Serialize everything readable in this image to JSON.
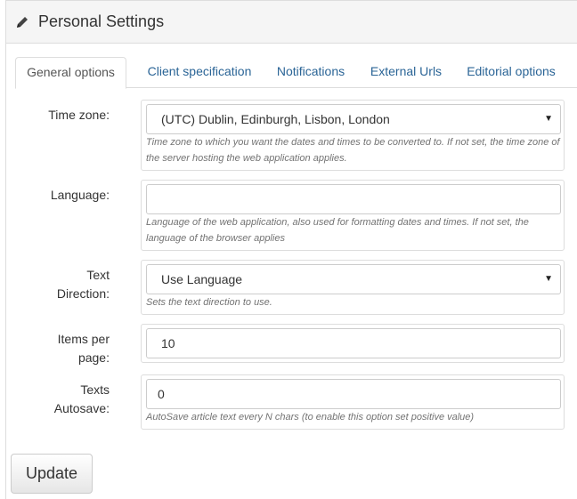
{
  "header": {
    "title": "Personal Settings",
    "icon": "pencil-icon"
  },
  "tabs": [
    {
      "label": "General options",
      "active": true
    },
    {
      "label": "Client specification",
      "active": false
    },
    {
      "label": "Notifications",
      "active": false
    },
    {
      "label": "External Urls",
      "active": false
    },
    {
      "label": "Editorial options",
      "active": false
    }
  ],
  "form": {
    "timezone": {
      "label": "Time zone:",
      "value": "(UTC) Dublin, Edinburgh, Lisbon, London",
      "help_line1": "Time zone to which you want the dates and times to be converted to. If not set, the time zone of",
      "help_line2": "the server hosting the web application applies."
    },
    "language": {
      "label": "Language:",
      "value": "",
      "help_line1": "Language of the web application, also used for formatting dates and times. If not set, the",
      "help_line2": "language of the browser applies"
    },
    "text_direction": {
      "label_line1": "Text",
      "label_line2": "Direction:",
      "value": "Use Language",
      "help": "Sets the text direction to use."
    },
    "items_per_page": {
      "label_line1": "Items per",
      "label_line2": "page:",
      "value": "10"
    },
    "texts_autosave": {
      "label_line1": "Texts",
      "label_line2": "Autosave:",
      "value": "0",
      "help": "AutoSave article text every N chars (to enable this option set positive value)"
    }
  },
  "actions": {
    "update_label": "Update"
  },
  "colors": {
    "link": "#2a6496",
    "border": "#dddddd",
    "heading_bg": "#f5f5f5"
  }
}
